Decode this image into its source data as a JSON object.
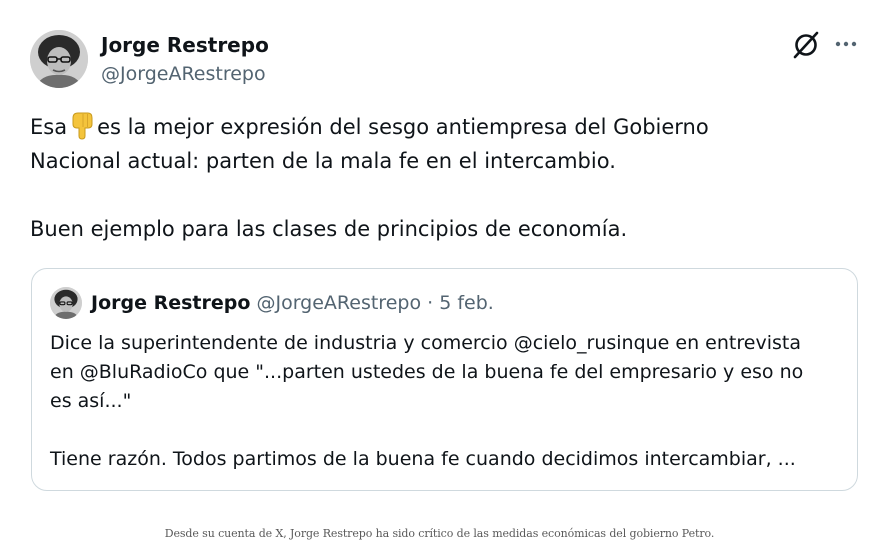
{
  "tweet": {
    "author_name": "Jorge Restrepo",
    "author_handle": "@JorgeARestrepo",
    "logo_icon": "x-logo-icon",
    "more_icon": "more-horizontal-icon",
    "text_before_emoji": "Esa",
    "emoji": "backhand-index-pointing-down",
    "text_after_emoji": "es la mejor expresión del sesgo antiempresa del Gobierno",
    "text_line2": "Nacional actual: parten de la mala fe en el intercambio.",
    "text_line3": "Buen ejemplo para las clases de principios de economía."
  },
  "quoted_tweet": {
    "author_name": "Jorge Restrepo",
    "author_handle": "@JorgeARestrepo",
    "separator": "·",
    "date": "5 feb.",
    "text_line1": "Dice la superintendente de industria y comercio @cielo_rusinque en entrevista",
    "text_line2": "en @BluRadioCo que \"...parten ustedes de la buena fe del empresario y eso no",
    "text_line3": "es así...\"",
    "text_line4": "Tiene razón. Todos partimos de la buena fe cuando decidimos intercambiar, ..."
  },
  "caption": "Desde su cuenta de X, Jorge Restrepo ha sido crítico de las medidas económicas del gobierno Petro.",
  "colors": {
    "text": "#0f1419",
    "secondary": "#536471",
    "border": "#cfd9de",
    "emoji": "#f4c43c"
  }
}
